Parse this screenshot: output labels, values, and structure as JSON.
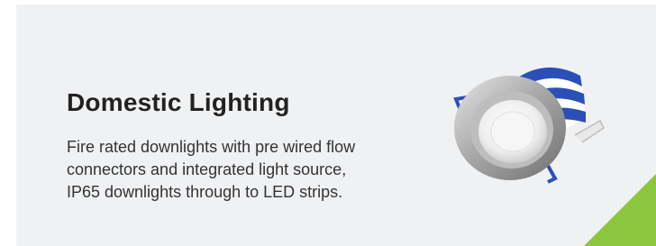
{
  "card": {
    "title": "Domestic Lighting",
    "description_lines": [
      "Fire rated downlights with pre wired flow",
      "connectors and integrated light source,",
      "IP65 downlights through to LED strips."
    ]
  },
  "colors": {
    "background": "#f0f1f3",
    "accent": "#8cc63f",
    "product_band": "#2b4fb8"
  },
  "icons": {
    "product_image": "downlight-image",
    "corner_decoration": "green-corner-triangle"
  }
}
